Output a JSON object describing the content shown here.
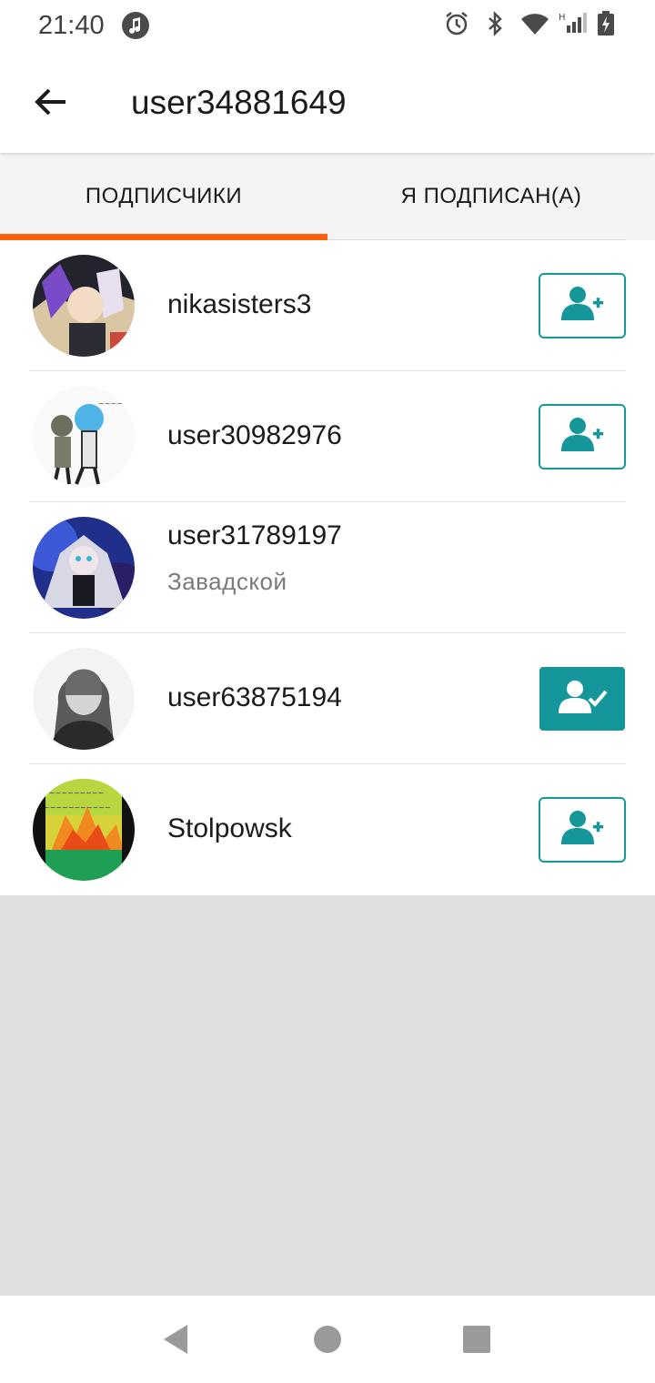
{
  "status_bar": {
    "time": "21:40",
    "icons": [
      "music-note-icon",
      "alarm-icon",
      "bluetooth-icon",
      "wifi-icon",
      "signal-icon",
      "battery-icon"
    ]
  },
  "header": {
    "title": "user34881649",
    "back_icon": "arrow-left-icon"
  },
  "tabs": [
    {
      "label": "ПОДПИСЧИКИ",
      "active": true
    },
    {
      "label": "Я ПОДПИСАН(А)",
      "active": false
    }
  ],
  "users": [
    {
      "name": "nikasisters3",
      "subtitle": "",
      "button": "follow"
    },
    {
      "name": "user30982976",
      "subtitle": "",
      "button": "follow"
    },
    {
      "name": "user31789197",
      "subtitle": "Завадской",
      "button": "none"
    },
    {
      "name": "user63875194",
      "subtitle": "",
      "button": "following"
    },
    {
      "name": "Stolpowsk",
      "subtitle": "",
      "button": "follow"
    }
  ],
  "colors": {
    "accent": "#ff5e0a",
    "teal": "#14969a",
    "empty_area": "#dfdee0"
  },
  "nav_bar": {
    "icons": [
      "nav-back-icon",
      "nav-home-icon",
      "nav-recents-icon"
    ]
  }
}
